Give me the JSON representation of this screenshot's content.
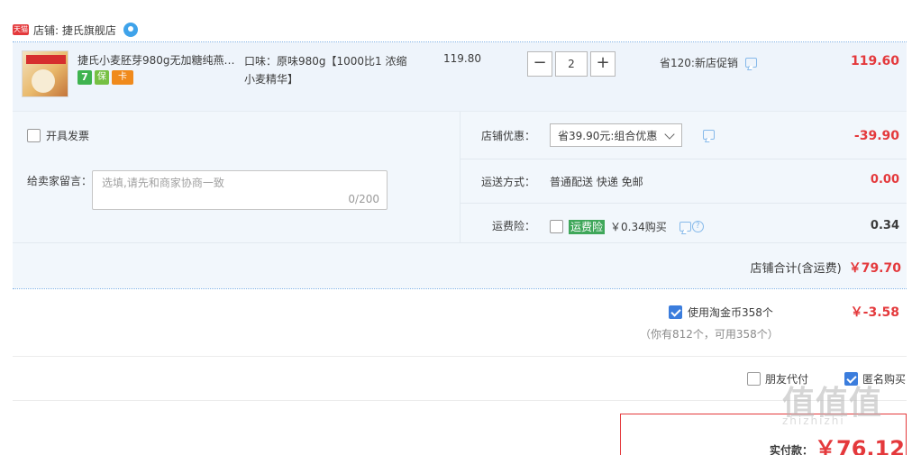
{
  "shop": {
    "badge": "天猫",
    "name": "店铺: 捷氏旗舰店"
  },
  "item": {
    "title": "捷氏小麦胚芽980g无加糖纯燕…",
    "badges": [
      "7",
      "保",
      "卡"
    ],
    "sku": "口味：原味980g【1000比1 浓缩小麦精华】",
    "price": "119.80",
    "quantity": "2",
    "qty_minus": "−",
    "qty_plus": "+",
    "promo": "省120:新店促销",
    "subtotal": "119.60"
  },
  "options": {
    "invoice_label": "开具发票",
    "memo_label": "给卖家留言：",
    "memo_placeholder": "选填,请先和商家协商一致",
    "memo_count": "0/200",
    "shop_discount_label": "店铺优惠：",
    "shop_discount_value": "省39.90元:组合优惠",
    "shop_discount_amount": "-39.90",
    "shipping_label": "运送方式：",
    "shipping_value": "普通配送 快递 免邮",
    "shipping_amount": "0.00",
    "insurance_label": "运费险：",
    "insurance_tag": "运费险",
    "insurance_price": "￥0.34购买",
    "insurance_amount": "0.34"
  },
  "shop_total": {
    "label": "店铺合计(含运费)",
    "amount": "￥79.70"
  },
  "coins": {
    "label": "使用淘金币358个",
    "amount": "￥-3.58",
    "note": "（你有812个，可用358个）"
  },
  "extras": {
    "friend_pay": "朋友代付",
    "anonymous": "匿名购买"
  },
  "payment": {
    "label": "实付款：",
    "amount": "￥76.12"
  },
  "watermark": {
    "main": "值值值",
    "sub": "zhizhizhi"
  },
  "colors": {
    "accent_red": "#e4393c",
    "panel_blue": "#eef4fb",
    "check_blue": "#3b7ddd",
    "insurance_green": "#3fa75a"
  }
}
